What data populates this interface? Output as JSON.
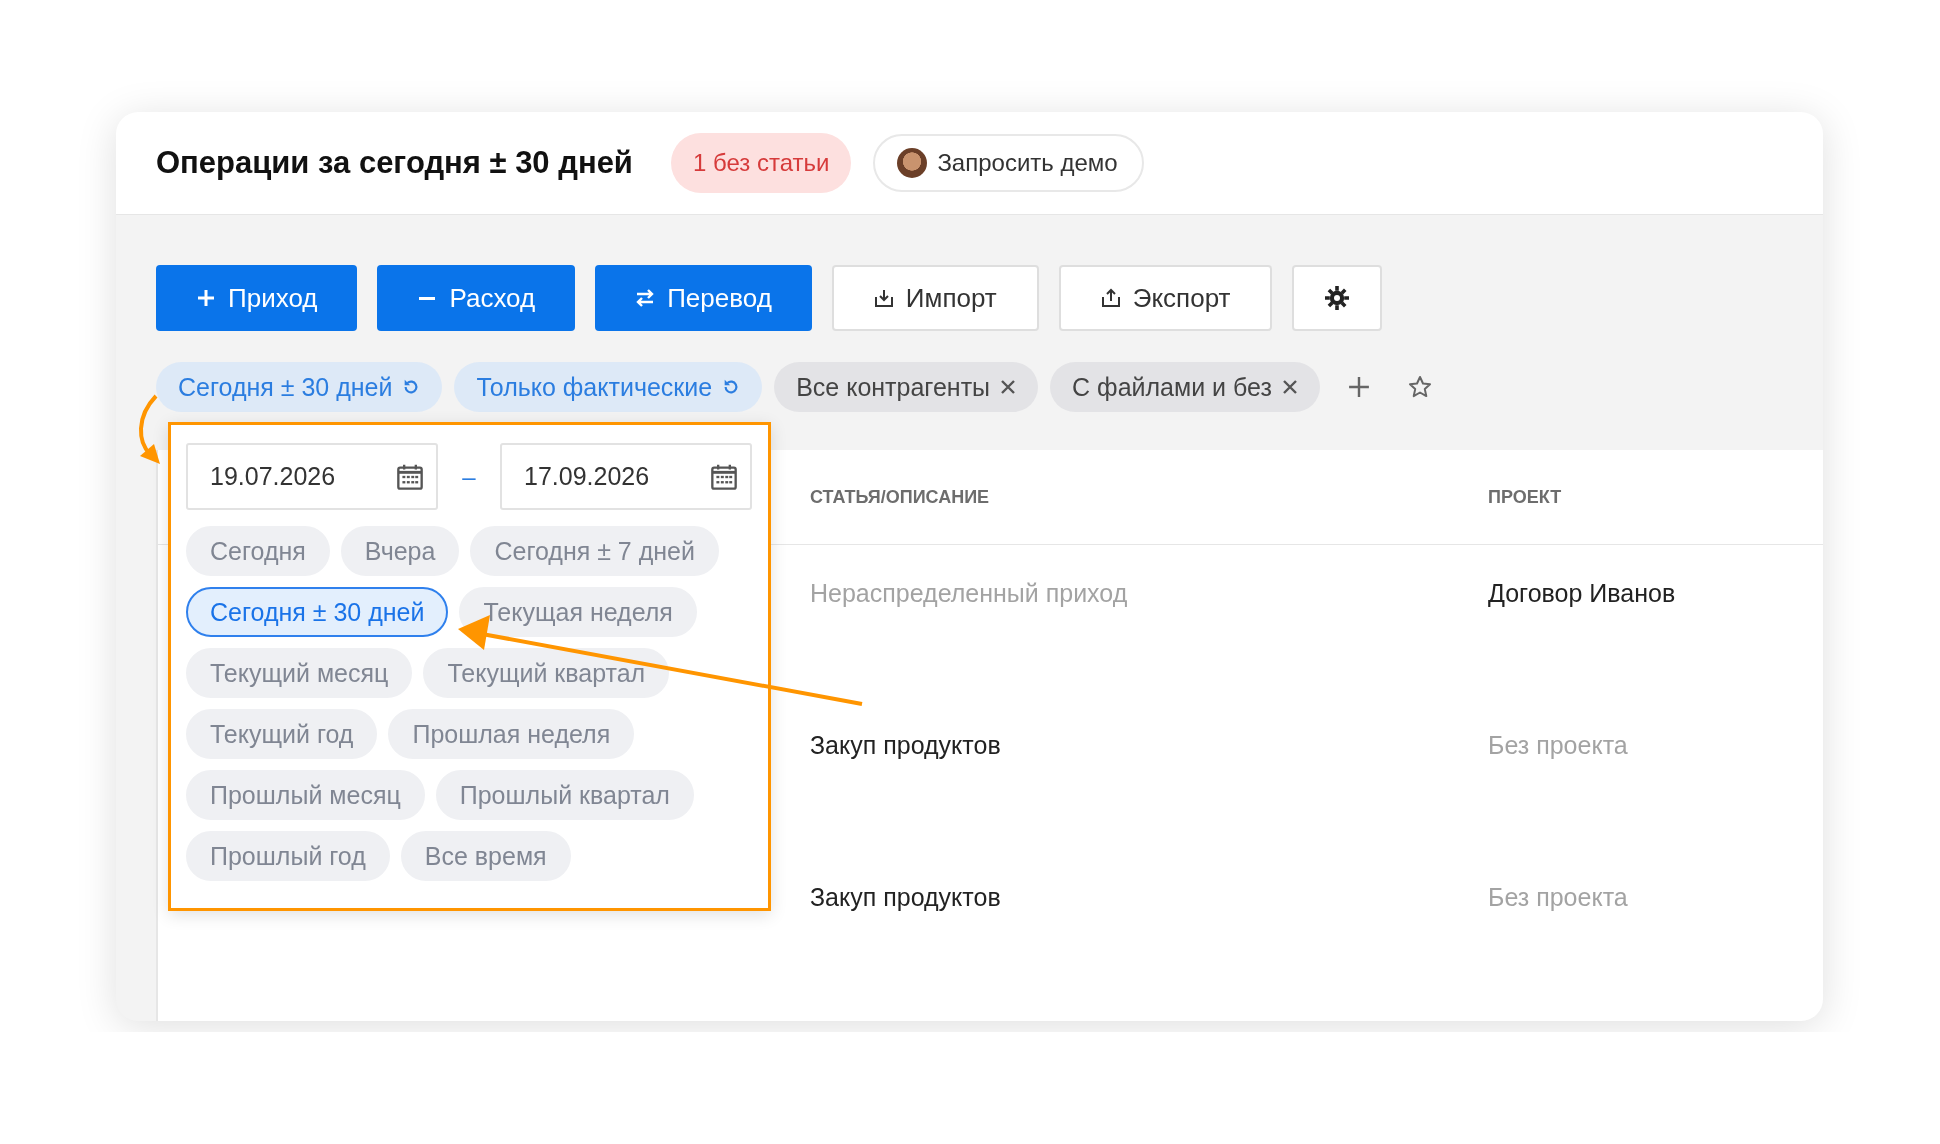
{
  "header": {
    "title": "Операции за сегодня ± 30 дней",
    "badge": "1 без статьи",
    "demo_button": "Запросить демо"
  },
  "toolbar": [
    {
      "label": "Приход",
      "kind": "primary"
    },
    {
      "label": "Расход",
      "kind": "primary"
    },
    {
      "label": "Перевод",
      "kind": "primary"
    },
    {
      "label": "Импорт",
      "kind": "secondary"
    },
    {
      "label": "Экспорт",
      "kind": "secondary"
    },
    {
      "kind": "icon"
    }
  ],
  "filters": [
    {
      "label": "Сегодня ± 30 дней",
      "kind": "default"
    },
    {
      "label": "Только фактические",
      "kind": "default"
    },
    {
      "label": "Все контрагенты",
      "kind": "custom"
    },
    {
      "label": "С файлами и без",
      "kind": "custom"
    }
  ],
  "date_popup": {
    "date_from": "19.07.2026",
    "date_to": "17.09.2026",
    "separator": "–",
    "presets": [
      {
        "label": "Сегодня",
        "selected": false
      },
      {
        "label": "Вчера",
        "selected": false
      },
      {
        "label": "Сегодня ± 7 дней",
        "selected": false
      },
      {
        "label": "Сегодня ± 30 дней",
        "selected": true
      },
      {
        "label": "Текущая неделя",
        "selected": false
      },
      {
        "label": "Текущий месяц",
        "selected": false
      },
      {
        "label": "Текущий квартал",
        "selected": false
      },
      {
        "label": "Текущий год",
        "selected": false
      },
      {
        "label": "Прошлая неделя",
        "selected": false
      },
      {
        "label": "Прошлый месяц",
        "selected": false
      },
      {
        "label": "Прошлый квартал",
        "selected": false
      },
      {
        "label": "Прошлый год",
        "selected": false
      },
      {
        "label": "Все время",
        "selected": false
      }
    ]
  },
  "table": {
    "columns": [
      "СТАТЬЯ/ОПИСАНИЕ",
      "ПРОЕКТ"
    ],
    "rows": [
      {
        "description": {
          "text": "Нераспределенный приход",
          "muted": true
        },
        "project": {
          "text": "Договор Иванов",
          "muted": false
        }
      },
      {
        "description": {
          "text": "Закуп продуктов",
          "muted": false
        },
        "project": {
          "text": "Без проекта",
          "muted": true
        }
      },
      {
        "description": {
          "text": "Закуп продуктов",
          "muted": false
        },
        "project": {
          "text": "Без проекта",
          "muted": true
        }
      }
    ]
  }
}
